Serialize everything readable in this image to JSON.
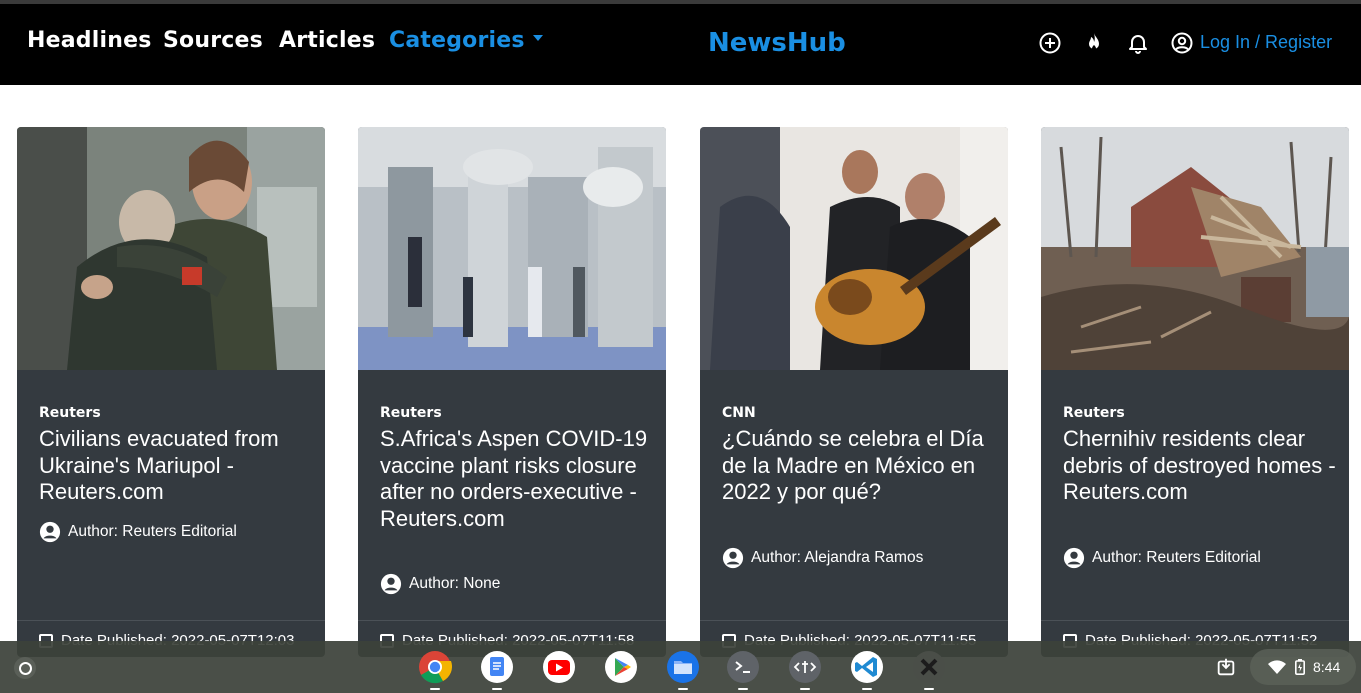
{
  "nav": {
    "links": [
      "Headlines",
      "Sources",
      "Articles"
    ],
    "categories_label": "Categories",
    "brand": "NewsHub",
    "login_label": "Log In / Register",
    "accent_color": "#1a8fe3"
  },
  "articles": [
    {
      "source": "Reuters",
      "title": "Civilians evacuated from Ukraine's Mariupol - Reuters.com",
      "author": "Author: Reuters Editorial",
      "date": "Date Published: 2022-05-07T12:03"
    },
    {
      "source": "Reuters",
      "title": "S.Africa's Aspen COVID-19 vaccine plant risks closure after no orders-executive - Reuters.com",
      "author": "Author: None",
      "date": "Date Published: 2022-05-07T11:58"
    },
    {
      "source": "CNN",
      "title": "¿Cuándo se celebra el Día de la Madre en México en 2022 y por qué?",
      "author": "Author: Alejandra Ramos",
      "date": "Date Published: 2022-05-07T11:55"
    },
    {
      "source": "Reuters",
      "title": "Chernihiv residents clear debris of destroyed homes - Reuters.com",
      "author": "Author: Reuters Editorial",
      "date": "Date Published: 2022-05-07T11:52"
    }
  ],
  "shelf": {
    "apps": [
      "chrome-icon",
      "docs-icon",
      "youtube-icon",
      "play-store-icon",
      "files-icon",
      "terminal-icon",
      "text-editor-icon",
      "vscode-icon",
      "x-app-icon"
    ],
    "time": "8:44"
  }
}
